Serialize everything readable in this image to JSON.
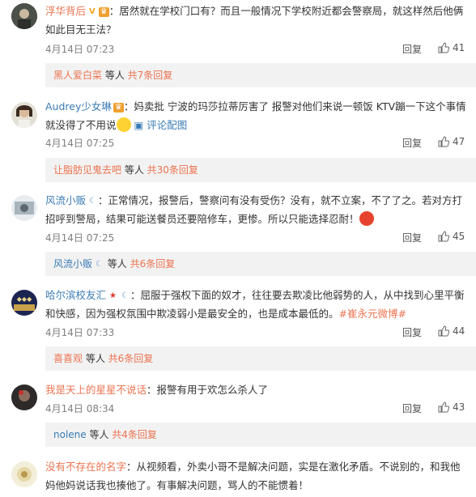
{
  "comments": [
    {
      "user": "浮华背后",
      "badge_v": "V",
      "text": "：居然就在学校门口有？而且一般情况下学校附近都会警察局，就这样然后他俩如此目无王法？",
      "time": "4月14日 07:23",
      "reply_label": "回复",
      "likes": "41",
      "sub_user": "黑人爱白菜",
      "sub_mid": " 等人 ",
      "sub_count": "共7条回复"
    },
    {
      "user": "Audrey少女琳",
      "text": "：妈卖批 宁波的玛莎拉蒂厉害了 报警对他们来说一顿饭 KTV蹦一下这个事情就没得了不用说",
      "extra_link": "评论配图",
      "time": "4月14日 07:25",
      "reply_label": "回复",
      "likes": "47",
      "sub_user": "让脂肪见鬼去吧",
      "sub_mid": " 等人 ",
      "sub_count": "共30条回复"
    },
    {
      "user": "风流小贩",
      "text": "：正常情况，报警后，警察问有没有受伤？没有，就不立案，不了了之。若对方打招呼到警局，结果可能送餐员还要陪修车，更惨。所以只能选择忍耐！",
      "time": "4月14日 07:25",
      "reply_label": "回复",
      "likes": "45",
      "sub_user": "风流小贩",
      "sub_mid": " 等人 ",
      "sub_count": "共6条回复"
    },
    {
      "user": "哈尔滨校友汇",
      "text": "：屈服于强权下面的奴才，往往要去欺凌比他弱势的人，从中找到心里平衡和快感，因为强权氛围中欺凌弱小是最安全的，也是成本最低的。",
      "hashtag": "#崔永元微博#",
      "time": "4月14日 07:33",
      "reply_label": "回复",
      "likes": "44",
      "sub_user": "喜喜观",
      "sub_mid": " 等人 ",
      "sub_count": "共6条回复"
    },
    {
      "user": "我是天上的星星不说话",
      "text": "：报警有用于欢怎么杀人了",
      "time": "4月14日 08:34",
      "reply_label": "回复",
      "likes": "43",
      "sub_user": "nolene",
      "sub_mid": " 等人 ",
      "sub_count": "共4条回复"
    },
    {
      "user": "没有不存在的名字",
      "text": "：从视频看，外卖小哥不是解决问题，实是在激化矛盾。不说别的，和我他妈他妈说话我也揍他了。有事解决问题，骂人的不能惯着！"
    }
  ],
  "colors": {
    "accent": "#eb7350",
    "link_blue": "#3a7bb5",
    "sub_bg": "#f2f2f2",
    "meta": "#808080"
  }
}
